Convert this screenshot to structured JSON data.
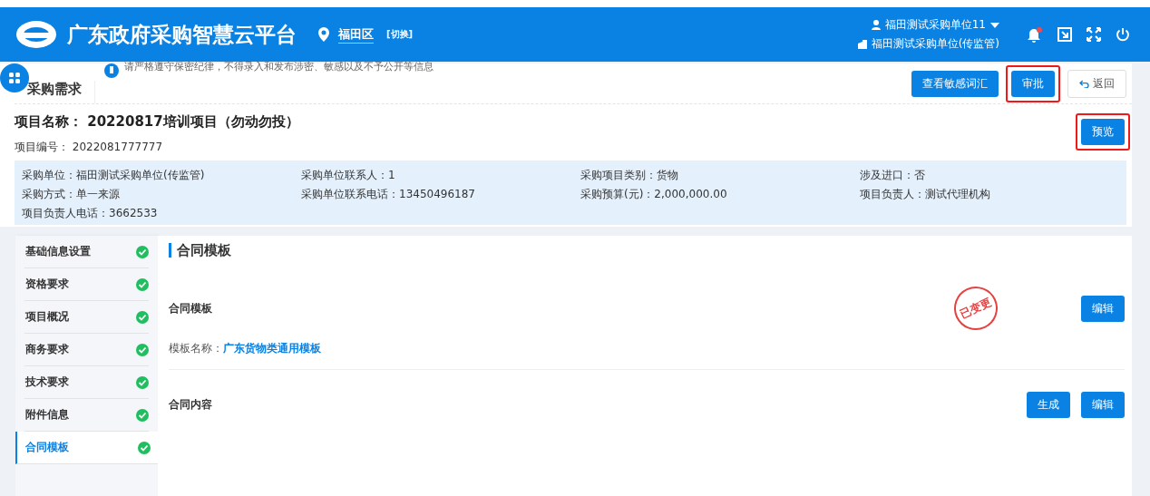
{
  "header": {
    "title": "广东政府采购智慧云平台",
    "region": "福田区",
    "switch_link": "[切换]",
    "user": "福田测试采购单位11",
    "org": "福田测试采购单位(传监管)",
    "notification": true
  },
  "page": {
    "title": "采购需求",
    "notice": "请严格遵守保密纪律，不得录入和发布涉密、敏感以及不予公开等信息",
    "buttons": [
      {
        "label": "查看敏感词汇",
        "kind": "primary",
        "highlighted": false
      },
      {
        "label": "审批",
        "kind": "primary",
        "highlighted": true
      },
      {
        "label": "返回",
        "kind": "back",
        "highlighted": false
      }
    ]
  },
  "project": {
    "name": "项目名称： 20220817培训项目（勿动勿投）",
    "number": "项目编号： 2022081777777",
    "preview_button": {
      "label": "预览",
      "highlighted": true
    },
    "info": [
      {
        "label": "采购单位：",
        "value": "福田测试采购单位(传监管)"
      },
      {
        "label": "采购单位联系人：",
        "value": "1"
      },
      {
        "label": "采购项目类别：",
        "value": "货物"
      },
      {
        "label": "涉及进口：",
        "value": "否"
      },
      {
        "label": "采购方式：",
        "value": "单一来源"
      },
      {
        "label": "采购单位联系电话：",
        "value": "13450496187"
      },
      {
        "label": "采购预算(元)：",
        "value": "2,000,000.00"
      },
      {
        "label": "项目负责人：",
        "value": "测试代理机构"
      },
      {
        "label": "项目负责人电话：",
        "value": "3662533"
      }
    ]
  },
  "steps": [
    {
      "label": "基础信息设置",
      "done": true,
      "selected": false
    },
    {
      "label": "资格要求",
      "done": true,
      "selected": false
    },
    {
      "label": "项目概况",
      "done": true,
      "selected": false
    },
    {
      "label": "商务要求",
      "done": true,
      "selected": false
    },
    {
      "label": "技术要求",
      "done": true,
      "selected": false
    },
    {
      "label": "附件信息",
      "done": true,
      "selected": false
    },
    {
      "label": "合同模板",
      "done": true,
      "selected": true
    }
  ],
  "panel": {
    "title": "合同模板",
    "sections": [
      {
        "title": "合同模板",
        "stamp": "已变更",
        "field_label": "模板名称：",
        "field_value": "广东货物类通用模板",
        "buttons": [
          "编辑"
        ]
      },
      {
        "title": "合同内容",
        "buttons": [
          "生成",
          "编辑"
        ]
      }
    ]
  }
}
